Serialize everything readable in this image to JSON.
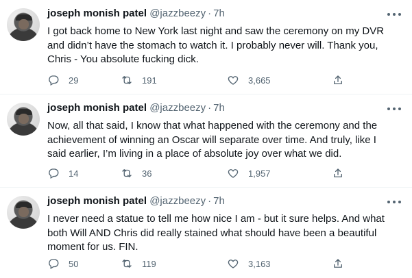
{
  "colors": {
    "text": "#0f1419",
    "muted": "#536471",
    "divider": "#eff3f4"
  },
  "icons": [
    "more-icon",
    "reply-icon",
    "retweet-icon",
    "like-icon",
    "share-icon"
  ],
  "tweets": [
    {
      "author": "joseph monish patel",
      "handle": "@jazzbeezy",
      "separator": "·",
      "time": "7h",
      "text": "I got back home to New York last night and saw the ceremony on my DVR and didn’t have the stomach to watch it. I probably never will. Thank you, Chris - You absolute fucking dick.",
      "replies": "29",
      "retweets": "191",
      "likes": "3,665"
    },
    {
      "author": "joseph monish patel",
      "handle": "@jazzbeezy",
      "separator": "·",
      "time": "7h",
      "text": "Now, all that said, I know that what happened with the ceremony and the achievement of winning an Oscar will separate over time. And truly, like I said earlier, I’m living in a place of absolute joy over what we did.",
      "replies": "14",
      "retweets": "36",
      "likes": "1,957"
    },
    {
      "author": "joseph monish patel",
      "handle": "@jazzbeezy",
      "separator": "·",
      "time": "7h",
      "text": "I never need a statue to tell me how nice I am - but it sure helps. And what both Will AND Chris did really stained what should have been a beautiful moment for us. FIN.",
      "replies": "50",
      "retweets": "119",
      "likes": "3,163"
    }
  ]
}
